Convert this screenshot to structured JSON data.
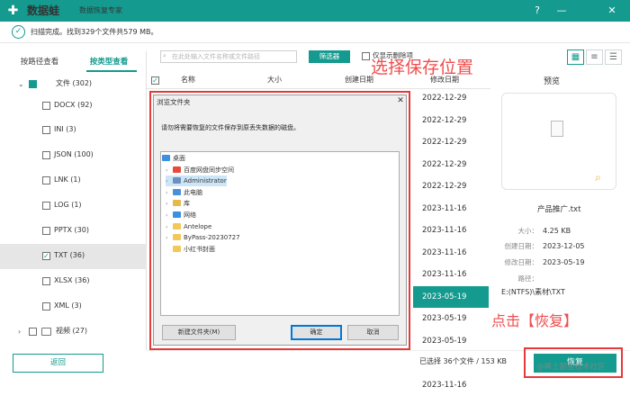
{
  "app": {
    "logo": "✚",
    "name": "数据蛙",
    "subtitle": "数据恢复专家"
  },
  "window_controls": {
    "help": "?",
    "minimize": "—",
    "close": "✕"
  },
  "status": {
    "icon": "check-icon",
    "text": "扫描完成。找到329个文件共579 MB。"
  },
  "sidebar": {
    "tabs": [
      {
        "label": "按路径查看",
        "active": false
      },
      {
        "label": "按类型查看",
        "active": true
      }
    ],
    "tree": [
      {
        "label": "文件 (302)",
        "checked": "partial",
        "expanded": true
      },
      {
        "label": "DOCX (92)",
        "checked": false
      },
      {
        "label": "INI (3)",
        "checked": false
      },
      {
        "label": "JSON (100)",
        "checked": false
      },
      {
        "label": "LNK (1)",
        "checked": false
      },
      {
        "label": "LOG (1)",
        "checked": false
      },
      {
        "label": "PPTX (30)",
        "checked": false
      },
      {
        "label": "TXT (36)",
        "checked": true,
        "selected": true
      },
      {
        "label": "XLSX (36)",
        "checked": false
      },
      {
        "label": "XML (3)",
        "checked": false
      },
      {
        "label": "视频 (27)",
        "checked": false,
        "expanded": false
      }
    ],
    "back_label": "返回"
  },
  "toolbar": {
    "search_placeholder": "在此处输入文件名称或文件路径",
    "filter_label": "筛选器",
    "show_deleted_label": "仅显示删除项"
  },
  "table": {
    "columns": [
      "名称",
      "大小",
      "创建日期",
      "修改日期"
    ],
    "modified_dates": [
      "2022-12-29",
      "2022-12-29",
      "2022-12-29",
      "2022-12-29",
      "2022-12-29",
      "2023-11-16",
      "2023-11-16",
      "2023-11-16",
      "2023-11-16",
      "2023-05-19",
      "2023-05-19",
      "2023-05-19",
      "2023-05-19",
      "2023-11-16"
    ],
    "selected_index": 9
  },
  "preview": {
    "title": "预览",
    "file_name": "产品推广.txt",
    "meta": [
      {
        "key": "大小：",
        "value": "4.25 KB"
      },
      {
        "key": "创建日期：",
        "value": "2023-12-05"
      },
      {
        "key": "修改日期：",
        "value": "2023-05-19"
      },
      {
        "key": "路径：",
        "value": ""
      }
    ],
    "path": "E:(NTFS)\\素材\\TXT"
  },
  "footer": {
    "selected_info": "已选择 36个文件 / 153 KB",
    "recover_label": "恢复",
    "watermark": "@稀土掘金技术社区"
  },
  "annotations": {
    "choose_location": "选择保存位置",
    "click_recover": "点击【恢复】",
    "color": "#f04d4d"
  },
  "dialog": {
    "title": "浏览文件夹",
    "close": "✕",
    "description": "请勿将需要恢复的文件保存到原丢失数据的磁盘。",
    "folders": [
      {
        "label": "桌面",
        "arrow": false,
        "color": "#3d8fe0",
        "indent": 0
      },
      {
        "label": "百度网盘同步空间",
        "arrow": true,
        "color": "#e64b3b",
        "indent": 1
      },
      {
        "label": "Administrator",
        "arrow": true,
        "color": "#6e8fbd",
        "indent": 1,
        "selected": true
      },
      {
        "label": "此电脑",
        "arrow": true,
        "color": "#4a90d9",
        "indent": 1
      },
      {
        "label": "库",
        "arrow": true,
        "color": "#e6b94a",
        "indent": 1
      },
      {
        "label": "网络",
        "arrow": true,
        "color": "#3d8fe0",
        "indent": 1
      },
      {
        "label": "Antelope",
        "arrow": true,
        "color": "#f2c85b",
        "indent": 1
      },
      {
        "label": "ByPass-20230727",
        "arrow": true,
        "color": "#f2c85b",
        "indent": 1
      },
      {
        "label": "小红书封面",
        "arrow": false,
        "color": "#f2c85b",
        "indent": 1
      }
    ],
    "new_folder_label": "新建文件夹(M)",
    "ok_label": "确定",
    "cancel_label": "取消"
  },
  "colors": {
    "accent": "#149a8e",
    "annotation_red": "#e53a3a"
  }
}
